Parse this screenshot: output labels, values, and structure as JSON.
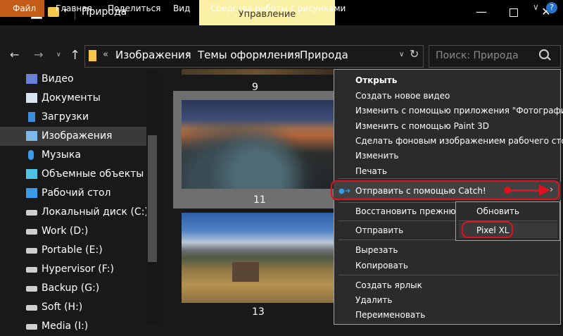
{
  "window": {
    "title": "Природа",
    "manage_tab": "Управление",
    "minimize": "—",
    "close": "✕"
  },
  "ribbon": {
    "tabs": [
      "Файл",
      "Главная",
      "Поделиться",
      "Вид",
      "Средства работы с рисунками"
    ],
    "chevron": "∨",
    "help": "?"
  },
  "addressbar": {
    "back": "←",
    "forward": "→",
    "up": "↑",
    "history_dropdown": "∨",
    "chevrons": "«",
    "path": [
      "Изображения",
      "Темы оформления",
      "Природа"
    ],
    "separator": "›",
    "dropdown": "∨",
    "refresh": "↻",
    "search_placeholder": "Поиск: Природа"
  },
  "sidebar": {
    "items": [
      {
        "label": "Видео",
        "icon": "video-icon",
        "color": "#6a7fd6"
      },
      {
        "label": "Документы",
        "icon": "documents-icon",
        "color": "#d9e3f0"
      },
      {
        "label": "Загрузки",
        "icon": "downloads-icon",
        "color": "#3c8ddc"
      },
      {
        "label": "Изображения",
        "icon": "pictures-icon",
        "color": "#7db9e8",
        "selected": true
      },
      {
        "label": "Музыка",
        "icon": "music-icon",
        "color": "#3c9be8"
      },
      {
        "label": "Объемные объекты",
        "icon": "3d-objects-icon",
        "color": "#4fc3e6"
      },
      {
        "label": "Рабочий стол",
        "icon": "desktop-icon",
        "color": "#3c9be8"
      },
      {
        "label": "Локальный диск (C:)",
        "icon": "system-drive-icon",
        "color": "#cfcfcf"
      },
      {
        "label": "Work (D:)",
        "icon": "drive-icon",
        "color": "#cfcfcf"
      },
      {
        "label": "Portable (E:)",
        "icon": "drive-icon",
        "color": "#cfcfcf"
      },
      {
        "label": "Hypervisor (F:)",
        "icon": "drive-icon",
        "color": "#cfcfcf"
      },
      {
        "label": "Backup (G:)",
        "icon": "drive-icon",
        "color": "#cfcfcf"
      },
      {
        "label": "Soft (H:)",
        "icon": "drive-icon",
        "color": "#cfcfcf"
      },
      {
        "label": "Media (I:)",
        "icon": "drive-icon",
        "color": "#cfcfcf"
      }
    ]
  },
  "content": {
    "captions": [
      "9",
      "11",
      "13"
    ]
  },
  "context_menu": {
    "open": "Открыть",
    "create_video": "Создать новое видео",
    "edit_photos": "Изменить с помощью приложения \"Фотографии\"",
    "edit_paint3d": "Изменить с помощью Paint 3D",
    "set_wallpaper": "Сделать фоновым изображением рабочего стола",
    "edit": "Изменить",
    "print": "Печать",
    "send_catch": "Отправить с помощью Catch!",
    "restore": "Восстановить прежнюю ве",
    "send_to": "Отправить",
    "cut": "Вырезать",
    "copy": "Копировать",
    "create_shortcut": "Создать ярлык",
    "delete": "Удалить",
    "rename": "Переименовать",
    "submenu_chevron": "›"
  },
  "submenu": {
    "refresh": "Обновить",
    "device": "Pixel XL"
  },
  "colors": {
    "accent_file_tab": "#c35c19",
    "manage_tab": "#f9f0a6",
    "annotation_red": "#e0101f"
  }
}
